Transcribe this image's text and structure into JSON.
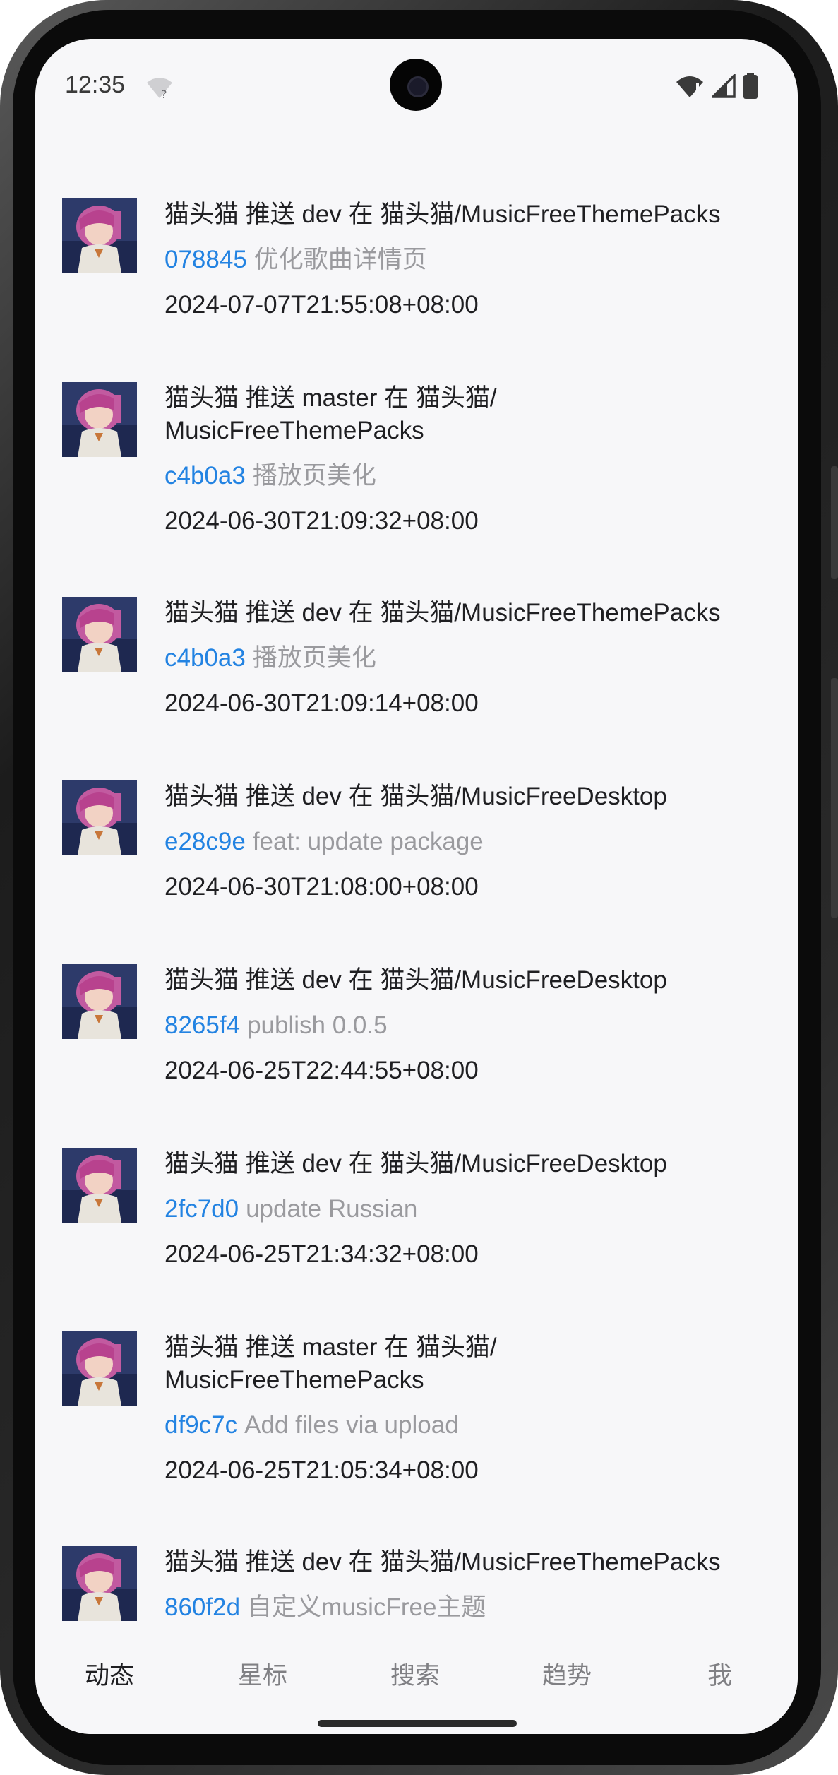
{
  "status_bar": {
    "time": "12:35",
    "icons": [
      "wifi-question-icon",
      "wifi-alert-icon",
      "signal-icon",
      "battery-icon"
    ]
  },
  "feed": {
    "events": [
      {
        "title": "猫头猫 推送 dev 在 猫头猫/MusicFreeThemePacks",
        "sha": "078845",
        "message": "优化歌曲详情页",
        "time": "2024-07-07T21:55:08+08:00"
      },
      {
        "title": "猫头猫 推送 master 在 猫头猫/\nMusicFreeThemePacks",
        "sha": "c4b0a3",
        "message": "播放页美化",
        "time": "2024-06-30T21:09:32+08:00"
      },
      {
        "title": "猫头猫 推送 dev 在 猫头猫/MusicFreeThemePacks",
        "sha": "c4b0a3",
        "message": "播放页美化",
        "time": "2024-06-30T21:09:14+08:00"
      },
      {
        "title": "猫头猫 推送 dev 在 猫头猫/MusicFreeDesktop",
        "sha": "e28c9e",
        "message": "feat: update package",
        "time": "2024-06-30T21:08:00+08:00"
      },
      {
        "title": "猫头猫 推送 dev 在 猫头猫/MusicFreeDesktop",
        "sha": "8265f4",
        "message": "publish 0.0.5",
        "time": "2024-06-25T22:44:55+08:00"
      },
      {
        "title": "猫头猫 推送 dev 在 猫头猫/MusicFreeDesktop",
        "sha": "2fc7d0",
        "message": "update Russian",
        "time": "2024-06-25T21:34:32+08:00"
      },
      {
        "title": "猫头猫 推送 master 在 猫头猫/\nMusicFreeThemePacks",
        "sha": "df9c7c",
        "message": "Add files via upload",
        "time": "2024-06-25T21:05:34+08:00"
      },
      {
        "title": "猫头猫 推送 dev 在 猫头猫/MusicFreeThemePacks",
        "sha": "860f2d",
        "message": "自定义musicFree主题",
        "time": ""
      }
    ]
  },
  "tabs": [
    {
      "label": "动态",
      "active": true
    },
    {
      "label": "星标",
      "active": false
    },
    {
      "label": "搜索",
      "active": false
    },
    {
      "label": "趋势",
      "active": false
    },
    {
      "label": "我",
      "active": false
    }
  ],
  "colors": {
    "accent": "#2383e2",
    "text": "#1f1f22",
    "muted": "#9a9a9e",
    "background": "#f7f7f9"
  }
}
